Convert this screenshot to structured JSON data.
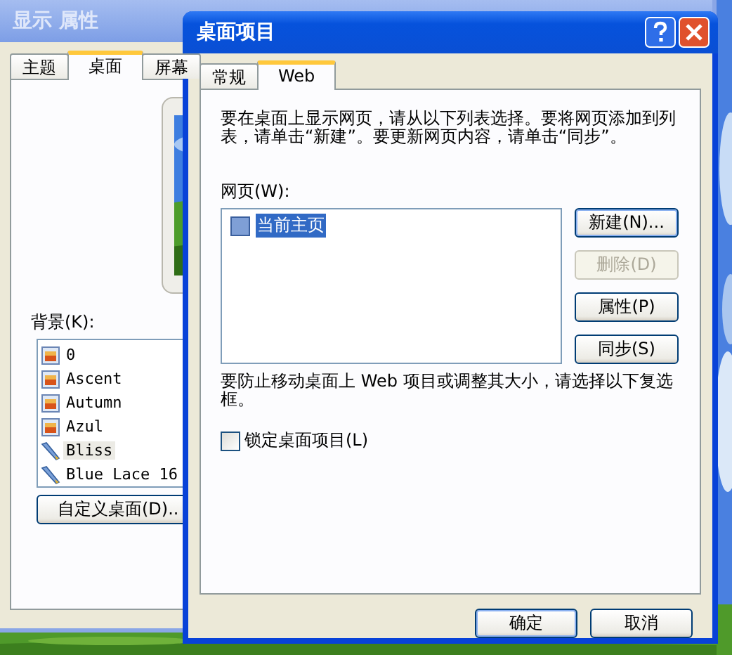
{
  "background_window": {
    "title": "显示 属性",
    "tabs": [
      {
        "label": "主题",
        "selected": false
      },
      {
        "label": "桌面",
        "selected": true
      },
      {
        "label": "屏幕",
        "selected": false
      }
    ],
    "background_label": "背景(K):",
    "backgrounds": [
      {
        "name": "0",
        "selected": false
      },
      {
        "name": "Ascent",
        "selected": false
      },
      {
        "name": "Autumn",
        "selected": false
      },
      {
        "name": "Azul",
        "selected": false
      },
      {
        "name": "Bliss",
        "kind": "paint",
        "selected": true
      },
      {
        "name": "Blue Lace 16",
        "kind": "paint",
        "selected": false
      }
    ],
    "customize_button": "自定义桌面(D).."
  },
  "dialog": {
    "title": "桌面项目",
    "tabs": [
      {
        "label": "常规",
        "selected": false
      },
      {
        "label": "Web",
        "selected": true
      }
    ],
    "intro": "要在桌面上显示网页，请从以下列表选择。要将网页添加到列表，请单击“新建”。要更新网页内容，请单击“同步”。",
    "pages_label": "网页(W):",
    "pages": [
      {
        "name": "当前主页",
        "checked": true,
        "selected": true
      }
    ],
    "side_buttons": [
      {
        "label": "新建(N)...",
        "disabled": false,
        "default": true
      },
      {
        "label": "删除(D)",
        "disabled": true,
        "default": false
      },
      {
        "label": "属性(P)",
        "disabled": false,
        "default": false
      },
      {
        "label": "同步(S)",
        "disabled": false,
        "default": false
      }
    ],
    "lock_hint": "要防止移动桌面上 Web 项目或调整其大小，请选择以下复选框。",
    "lock": {
      "label": "锁定桌面项目(L)",
      "checked": false
    },
    "buttons": [
      "确定",
      "取消"
    ]
  }
}
